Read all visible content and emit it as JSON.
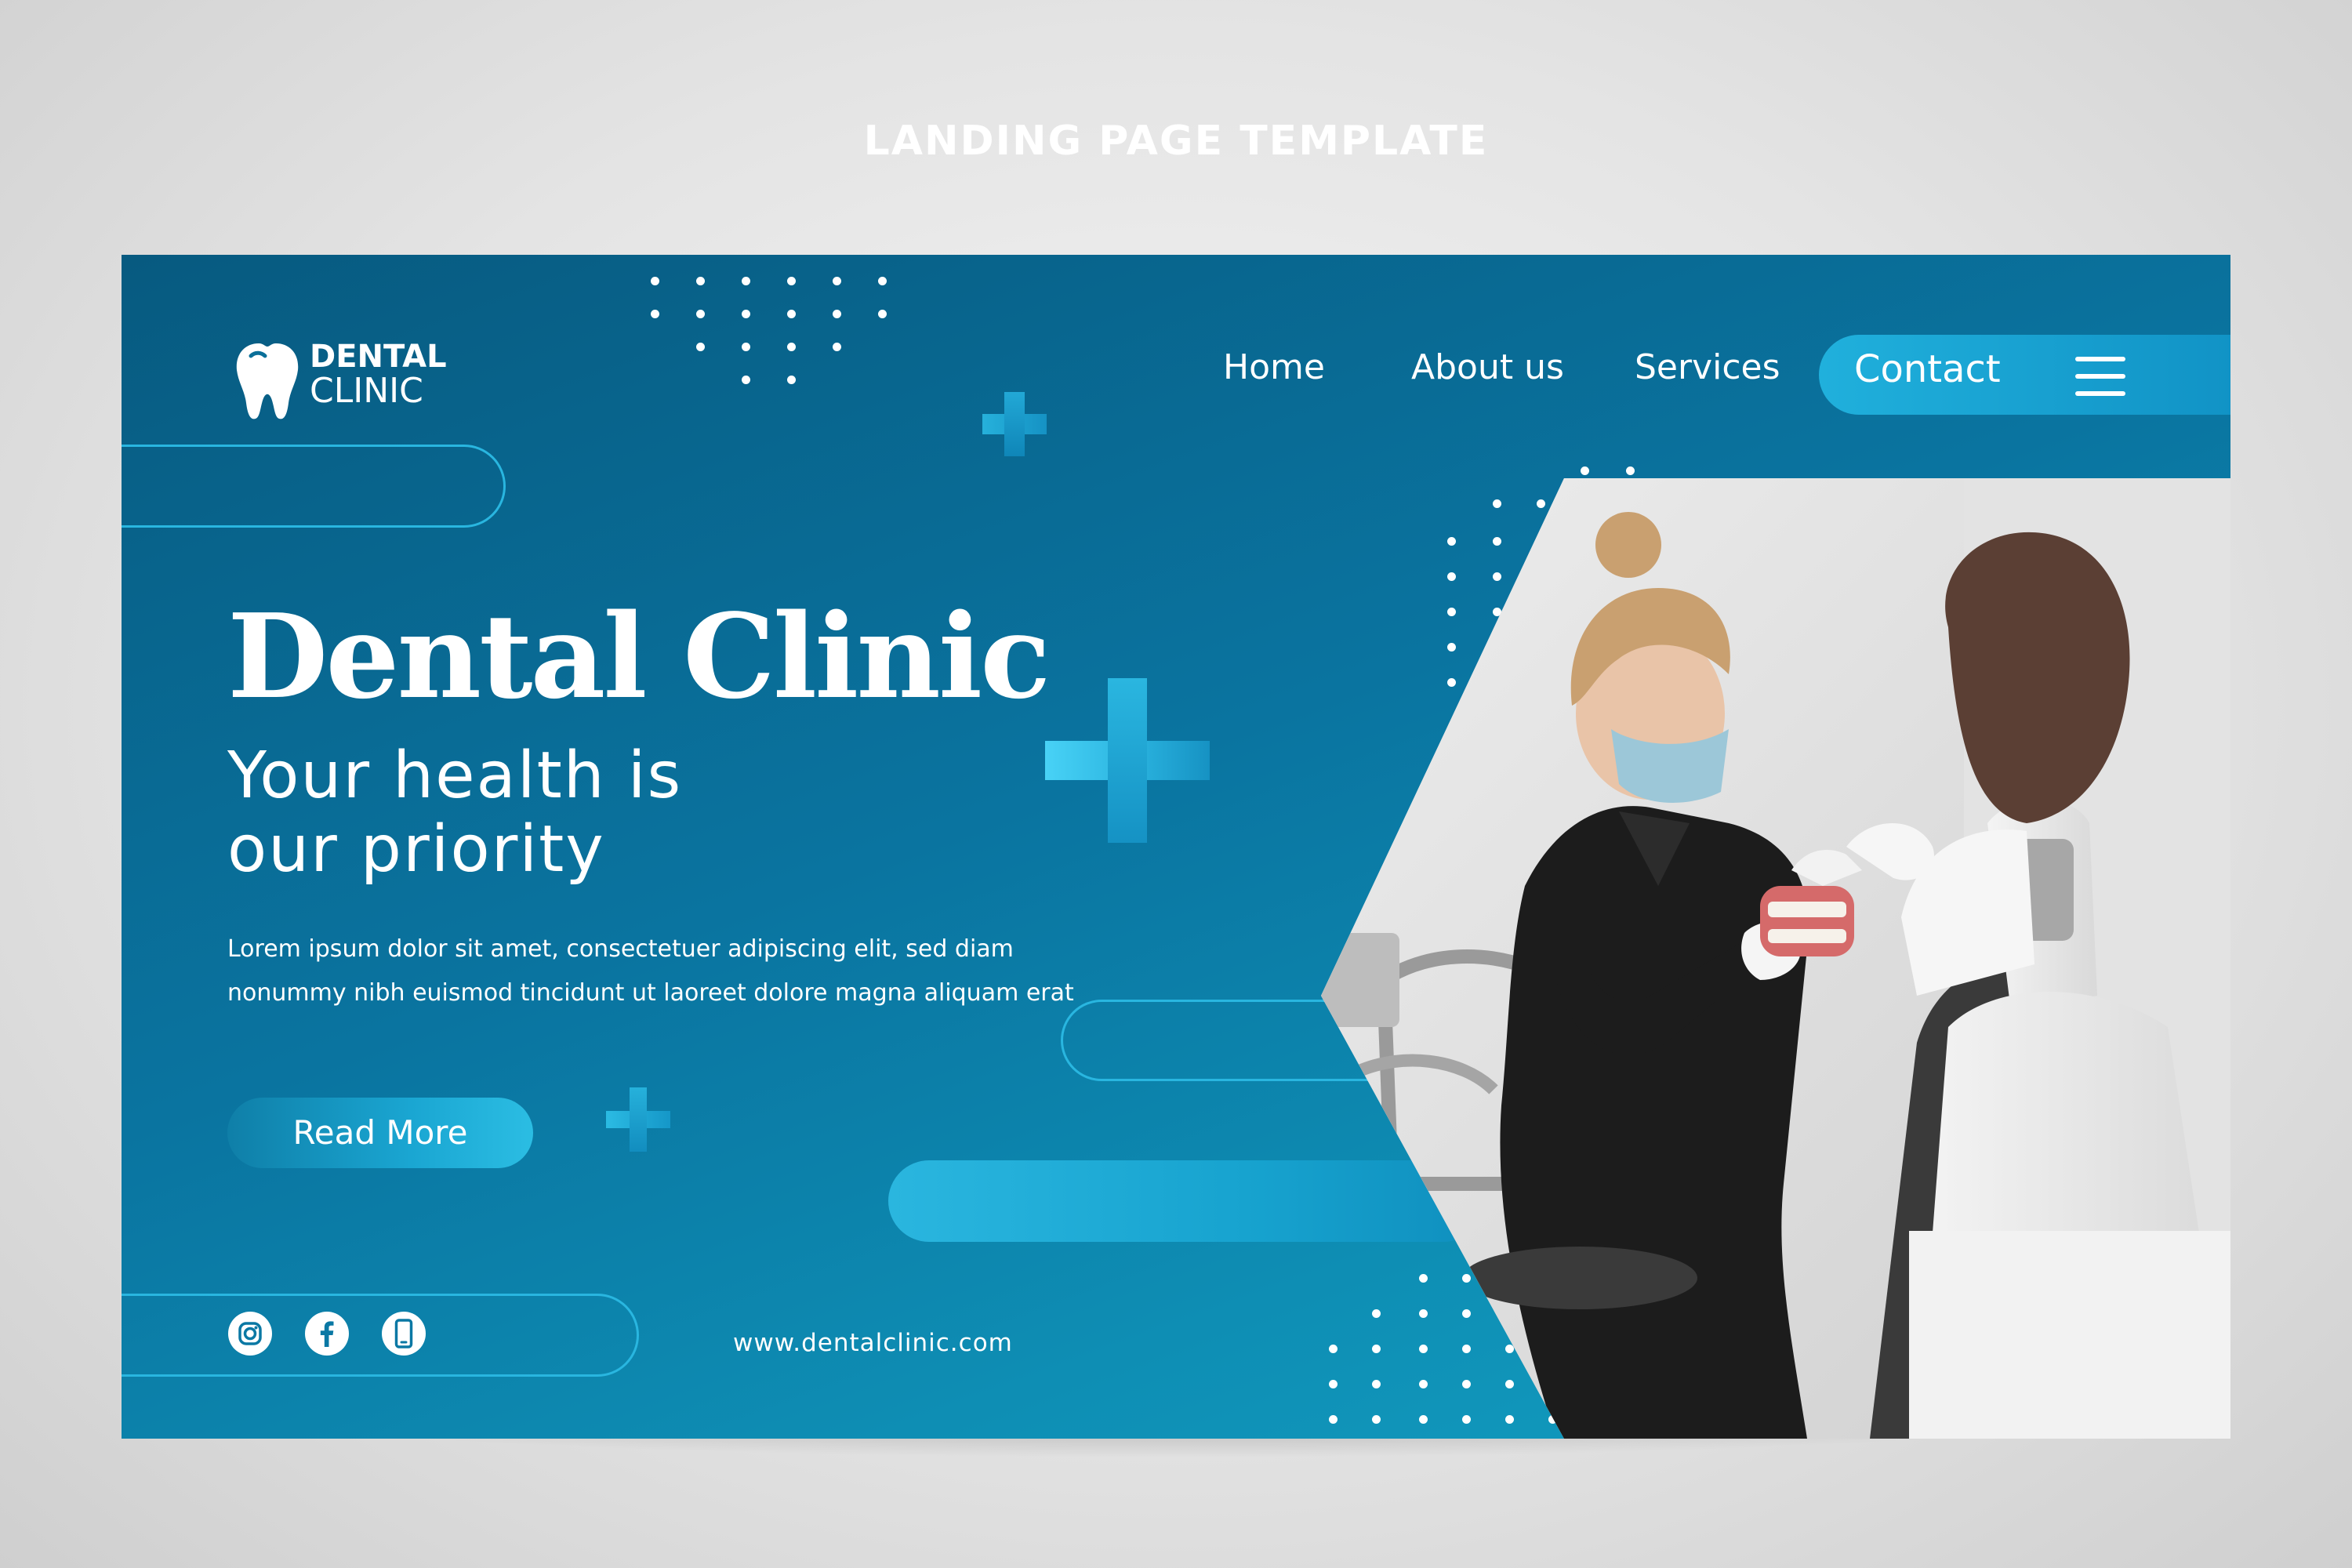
{
  "page": {
    "title": "LANDING PAGE TEMPLATE"
  },
  "brand": {
    "line1": "DENTAL",
    "line2": "CLINIC"
  },
  "nav": {
    "items": [
      {
        "label": "Home"
      },
      {
        "label": "About us"
      },
      {
        "label": "Services"
      }
    ],
    "contact_label": "Contact"
  },
  "hero": {
    "headline": "Dental Clinic",
    "subhead_line1": "Your health is",
    "subhead_line2": "our priority",
    "body": "Lorem ipsum dolor sit amet, consectetuer adipiscing elit, sed diam nonummy nibh euismod tincidunt ut laoreet dolore magna aliquam erat",
    "cta_label": "Read More"
  },
  "footer": {
    "social": [
      "instagram-icon",
      "facebook-icon",
      "phone-icon"
    ],
    "website": "www.dentalclinic.com"
  },
  "colors": {
    "primary_dark": "#075a80",
    "primary": "#0a74a0",
    "accent": "#29b6e0",
    "white": "#ffffff"
  }
}
